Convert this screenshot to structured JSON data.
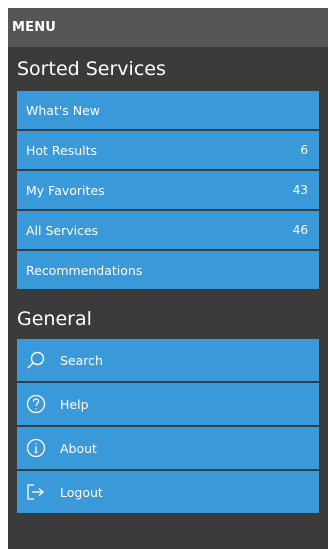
{
  "header": {
    "title": "MENU"
  },
  "sorted_services": {
    "title": "Sorted Services",
    "items": [
      {
        "label": "What's New",
        "count": ""
      },
      {
        "label": "Hot Results",
        "count": "6"
      },
      {
        "label": "My Favorites",
        "count": "43"
      },
      {
        "label": "All Services",
        "count": "46"
      },
      {
        "label": "Recommendations",
        "count": ""
      }
    ]
  },
  "general": {
    "title": "General",
    "items": [
      {
        "label": "Search",
        "icon": "search-icon"
      },
      {
        "label": "Help",
        "icon": "help-icon"
      },
      {
        "label": "About",
        "icon": "info-icon"
      },
      {
        "label": "Logout",
        "icon": "logout-icon"
      }
    ]
  },
  "colors": {
    "panel_bg": "#3b3b3b",
    "header_bg": "#555555",
    "item_bg": "#3a9ad9",
    "text": "#ffffff"
  }
}
